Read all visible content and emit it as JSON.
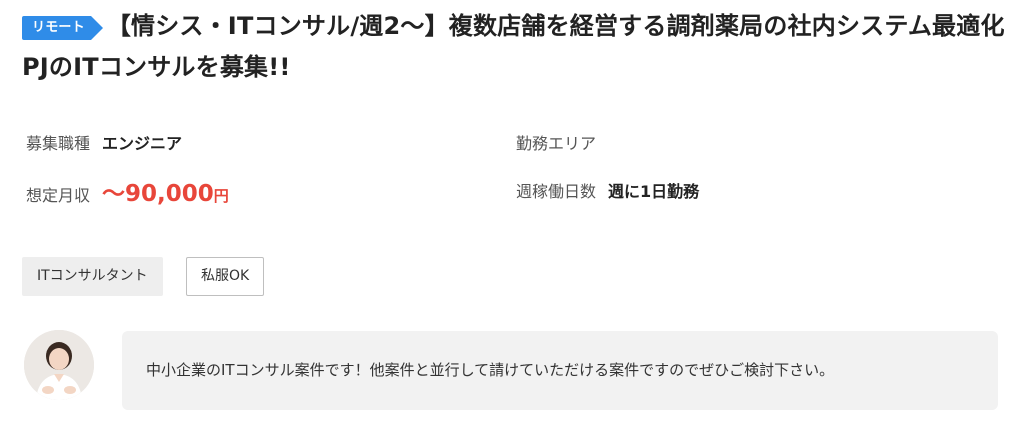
{
  "job": {
    "remote_badge": "リモート",
    "title": "【情シス・ITコンサル/週2〜】複数店舗を経営する調剤薬局の社内システム最適化PJのITコンサルを募集!!"
  },
  "details": {
    "position_label": "募集職種",
    "position_value": "エンジニア",
    "area_label": "勤務エリア",
    "area_value": "",
    "salary_label": "想定月収",
    "salary_amount": "〜90,000",
    "salary_unit": "円",
    "days_label": "週稼働日数",
    "days_value": "週に1日勤務"
  },
  "tags": [
    {
      "label": "ITコンサルタント",
      "style": "filled"
    },
    {
      "label": "私服OK",
      "style": "outline"
    }
  ],
  "comment": {
    "text": "中小企業のITコンサル案件です！他案件と並行して請けていただける案件ですのでぜひご検討下さい。"
  },
  "colors": {
    "accent": "#2f8ce8",
    "salary": "#e8463a",
    "tag_bg": "#eeeeee",
    "bubble_bg": "#f2f2f2"
  },
  "icons": {
    "avatar": "person-avatar"
  }
}
